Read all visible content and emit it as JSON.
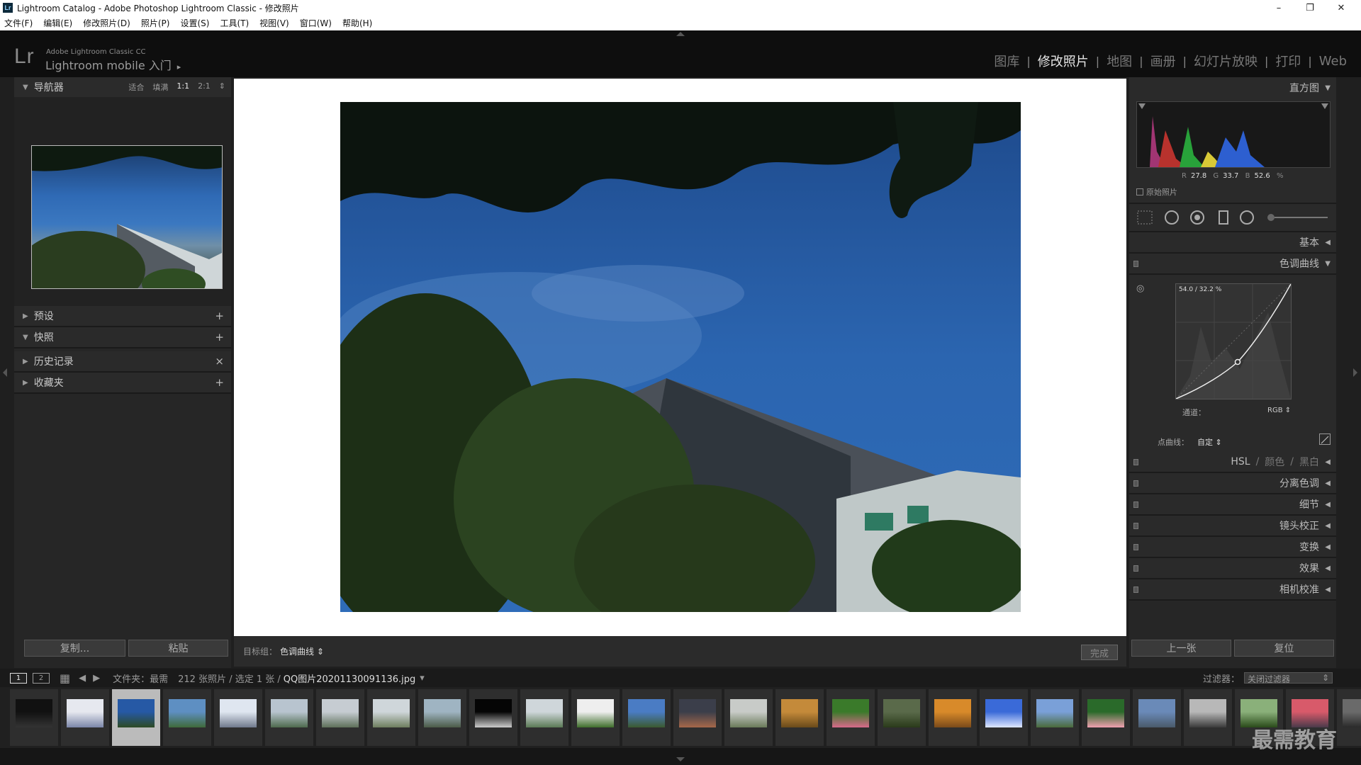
{
  "window": {
    "title": "Lightroom Catalog - Adobe Photoshop Lightroom Classic - 修改照片",
    "app_icon": "Lr",
    "minimize": "–",
    "restore": "❐",
    "close": "✕"
  },
  "menu": [
    "文件(F)",
    "编辑(E)",
    "修改照片(D)",
    "照片(P)",
    "设置(S)",
    "工具(T)",
    "视图(V)",
    "窗口(W)",
    "帮助(H)"
  ],
  "identity": {
    "logo": "Lr",
    "product": "Adobe Lightroom Classic CC",
    "mobile": "Lightroom mobile 入门",
    "arrow": "▸"
  },
  "modules": {
    "library": "图库",
    "develop": "修改照片",
    "map": "地图",
    "book": "画册",
    "slideshow": "幻灯片放映",
    "print": "打印",
    "web": "Web",
    "separator": "|"
  },
  "left": {
    "navigator": {
      "title": "导航器",
      "fit": "适合",
      "fill": "填满",
      "one": "1:1",
      "two": "2:1",
      "more": "⇕"
    },
    "presets": "预设",
    "snapshots": "快照",
    "history": "历史记录",
    "collections": "收藏夹",
    "plus": "+",
    "close": "×",
    "copy_button": "复制...",
    "paste_button": "粘贴"
  },
  "right": {
    "histogram": {
      "title": "直方图",
      "r_label": "R",
      "r": "27.8",
      "g_label": "G",
      "g": "33.7",
      "b_label": "B",
      "b": "52.6",
      "pct": "%",
      "original": "原始照片"
    },
    "basic": "基本",
    "tone_curve": {
      "title": "色调曲线",
      "readout": "54.0 / 32.2 %",
      "channel_label": "通道：",
      "channel": "RGB ⇕",
      "point_curve_label": "点曲线：",
      "point_curve": "自定 ⇕",
      "target_icon": "◎"
    },
    "hsl": {
      "hsl": "HSL",
      "slash": "/",
      "color": "颜色",
      "bw": "黑白"
    },
    "split": "分离色调",
    "detail": "细节",
    "lens": "镜头校正",
    "transform": "变换",
    "effects": "效果",
    "calibration": "相机校准",
    "prev_button": "上一张",
    "reset_button": "复位",
    "collapsed_arrow": "◀",
    "expanded_arrow": "▼"
  },
  "toolbar": {
    "target_label": "目标组：",
    "target_value": "色调曲线 ⇕",
    "done": "完成"
  },
  "filmbar": {
    "page1": "1",
    "page2": "2",
    "grid": "▦",
    "back": "◀",
    "forward": "▶",
    "source": "文件夹：最需",
    "count": "212 张照片 / 选定 1 张 /",
    "filename": "QQ图片20201130091136.jpg",
    "dropdown": "▾",
    "filter_label": "过滤器：",
    "filter_value": "关闭过滤器",
    "filter_arrow": "⇕"
  },
  "watermark": "最需教育",
  "colors": {
    "accent": "#e6e6e6",
    "panel": "#262626",
    "bg": "#1f1f1f"
  },
  "thumbs": [
    {
      "c1": "#111",
      "c2": "#333"
    },
    {
      "c1": "#e6e8ef",
      "c2": "#7b86a8"
    },
    {
      "c1": "#2659a5",
      "c2": "#2d4a24"
    },
    {
      "c1": "#5e8fc2",
      "c2": "#3f6a3a"
    },
    {
      "c1": "#dfe6f0",
      "c2": "#707a8c"
    },
    {
      "c1": "#b8c4cf",
      "c2": "#4e6a4d"
    },
    {
      "c1": "#c6ccd2",
      "c2": "#5e705a"
    },
    {
      "c1": "#cfd6da",
      "c2": "#6e7e5e"
    },
    {
      "c1": "#9fb4c2",
      "c2": "#4b5b48"
    },
    {
      "c1": "#050505",
      "c2": "#ccc"
    },
    {
      "c1": "#cfd6da",
      "c2": "#5b7a55"
    },
    {
      "c1": "#eeeeee",
      "c2": "#3f6e2b"
    },
    {
      "c1": "#4a7cc4",
      "c2": "#3b5a30"
    },
    {
      "c1": "#3b3e4a",
      "c2": "#a6684a"
    },
    {
      "c1": "#c8cbc8",
      "c2": "#6a7a5a"
    },
    {
      "c1": "#c48a3a",
      "c2": "#6a4a1a"
    },
    {
      "c1": "#3a7a2a",
      "c2": "#d86a8a"
    },
    {
      "c1": "#5a6a4a",
      "c2": "#2a3a1a"
    },
    {
      "c1": "#d88a2a",
      "c2": "#7a4a1a"
    },
    {
      "c1": "#3a6ad8",
      "c2": "#e0e8ff"
    },
    {
      "c1": "#7aa0d8",
      "c2": "#4a6a3a"
    },
    {
      "c1": "#2a6a2a",
      "c2": "#f0a0b0"
    },
    {
      "c1": "#6a8ab8",
      "c2": "#4a5a6a"
    },
    {
      "c1": "#b8b8b8",
      "c2": "#3a3a3a"
    },
    {
      "c1": "#8ab07a",
      "c2": "#2a4a1a"
    },
    {
      "c1": "#d85a6a",
      "c2": "#4a3a4a"
    },
    {
      "c1": "#6a6a6a",
      "c2": "#2a2a2a"
    }
  ]
}
